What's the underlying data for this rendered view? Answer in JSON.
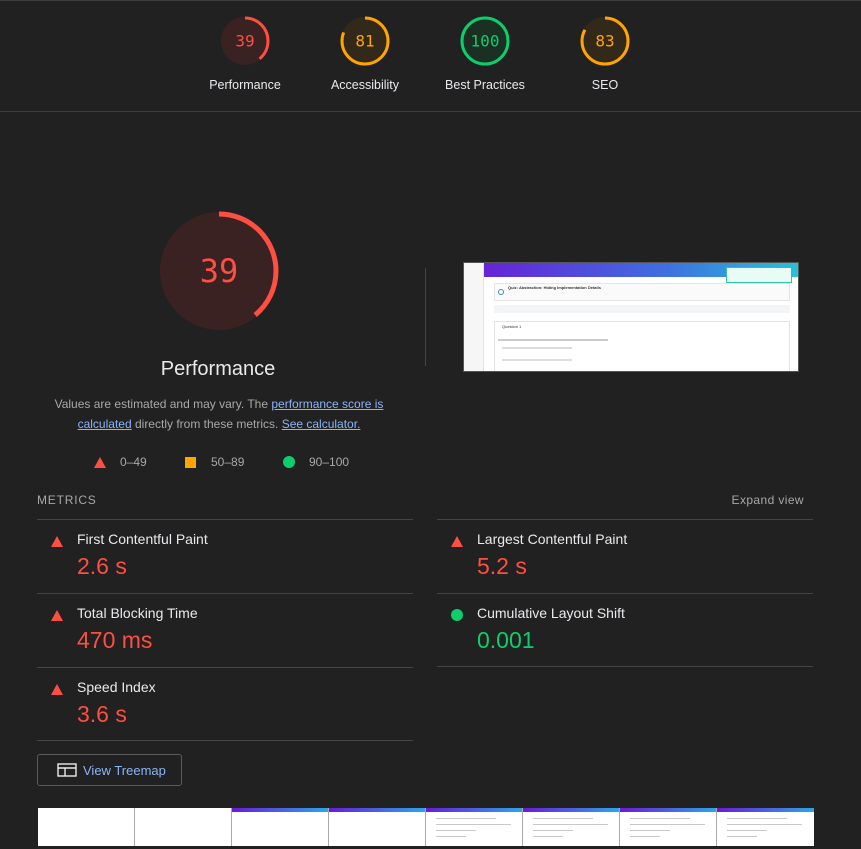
{
  "colors": {
    "bad": "#ff4e42",
    "average": "#ffa400",
    "good": "#0cce6b",
    "link": "#8ab4f8"
  },
  "categories": [
    {
      "label": "Performance",
      "score": 39,
      "status": "bad"
    },
    {
      "label": "Accessibility",
      "score": 81,
      "status": "average"
    },
    {
      "label": "Best Practices",
      "score": 100,
      "status": "good"
    },
    {
      "label": "SEO",
      "score": 83,
      "status": "average"
    }
  ],
  "main": {
    "score": "39",
    "score_value": 39,
    "title": "Performance",
    "desc_1": "Values are estimated and may vary. The ",
    "desc_link_1": "performance score is calculated",
    "desc_2": " directly from these metrics. ",
    "desc_link_2": "See calculator."
  },
  "legend": {
    "fail": "0–49",
    "average": "50–89",
    "pass": "90–100"
  },
  "screenshot": {
    "title": "Quiz: Abstraction: Hiding Implementation Details",
    "question": "Question 1"
  },
  "metrics_header": "METRICS",
  "expand_view": "Expand view",
  "metrics": {
    "fcp": {
      "name": "First Contentful Paint",
      "value": "2.6 s"
    },
    "lcp": {
      "name": "Largest Contentful Paint",
      "value": "5.2 s"
    },
    "tbt": {
      "name": "Total Blocking Time",
      "value": "470 ms"
    },
    "cls": {
      "name": "Cumulative Layout Shift",
      "value": "0.001"
    },
    "si": {
      "name": "Speed Index",
      "value": "3.6 s"
    }
  },
  "treemap_label": "View Treemap",
  "icons": [
    "treemap-icon",
    "fail-triangle-icon",
    "average-square-icon",
    "pass-circle-icon"
  ]
}
